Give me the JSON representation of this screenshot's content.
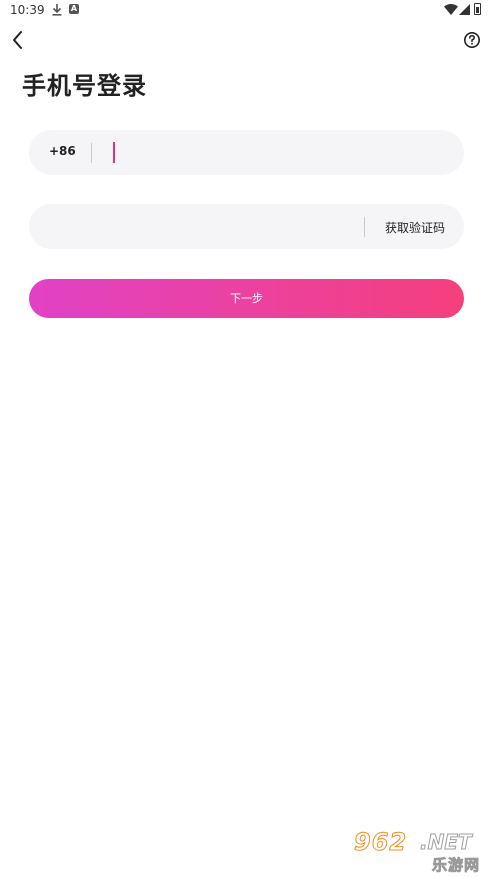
{
  "status_bar": {
    "time": "10:39",
    "a_badge": "A"
  },
  "header": {
    "back_icon": "chevron-left-icon",
    "help_icon": "question-circle-icon"
  },
  "page": {
    "title": "手机号登录"
  },
  "phone": {
    "country_code": "+86",
    "value": "",
    "placeholder": ""
  },
  "code": {
    "value": "",
    "placeholder": "",
    "get_code_label": "获取验证码"
  },
  "next_button": {
    "label": "下一步"
  },
  "watermark": {
    "number": "962",
    "domain": ".NET",
    "subtitle": "乐游网"
  },
  "colors": {
    "accent": "#e0307e",
    "gradient_start": "#e142c5",
    "gradient_end": "#f5407c",
    "field_bg": "#f5f5f7"
  }
}
